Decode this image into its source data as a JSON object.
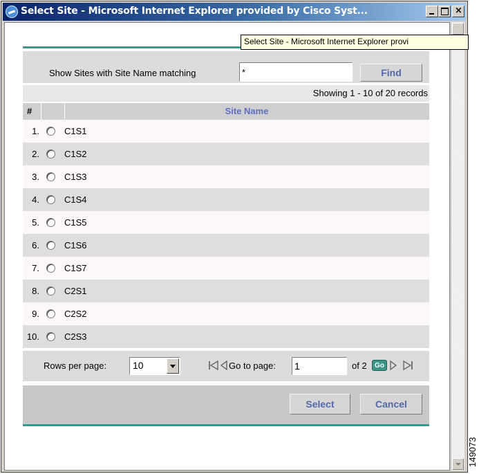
{
  "window": {
    "title": "Select Site - Microsoft Internet Explorer provided by Cisco Syst...",
    "tooltip": "Select Site - Microsoft Internet Explorer provi"
  },
  "filter": {
    "label": "Show Sites with Site Name matching",
    "value": "*",
    "find_label": "Find"
  },
  "records_text": "Showing 1 - 10 of 20 records",
  "table": {
    "col_number": "#",
    "col_site": "Site Name",
    "rows": [
      {
        "num": "1.",
        "name": "C1S1"
      },
      {
        "num": "2.",
        "name": "C1S2"
      },
      {
        "num": "3.",
        "name": "C1S3"
      },
      {
        "num": "4.",
        "name": "C1S4"
      },
      {
        "num": "5.",
        "name": "C1S5"
      },
      {
        "num": "6.",
        "name": "C1S6"
      },
      {
        "num": "7.",
        "name": "C1S7"
      },
      {
        "num": "8.",
        "name": "C2S1"
      },
      {
        "num": "9.",
        "name": "C2S2"
      },
      {
        "num": "10.",
        "name": "C2S3"
      }
    ]
  },
  "pager": {
    "rows_label": "Rows per page:",
    "rows_value": "10",
    "goto_label": "Go to page:",
    "goto_value": "1",
    "of_label": "of 2",
    "go_label": "Go"
  },
  "actions": {
    "select_label": "Select",
    "cancel_label": "Cancel"
  },
  "figure_id": "149073"
}
